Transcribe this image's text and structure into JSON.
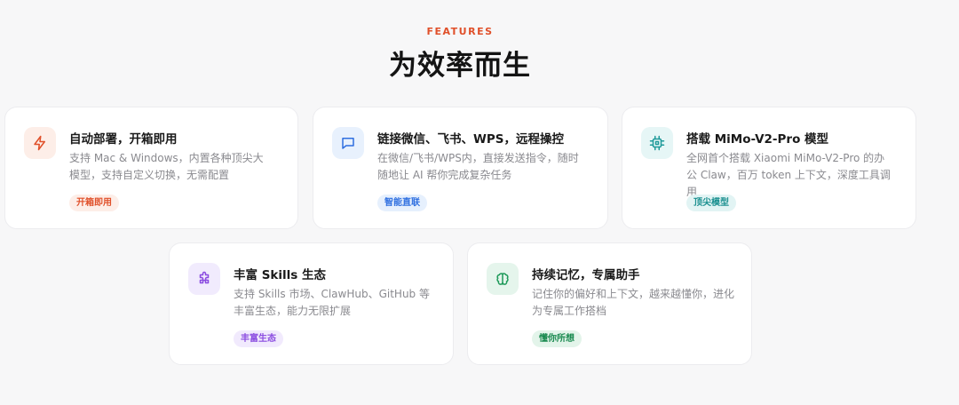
{
  "section": {
    "eyebrow": "FEATURES",
    "title": "为效率而生"
  },
  "features": [
    {
      "title": "自动部署，开箱即用",
      "description": "支持 Mac & Windows，内置各种顶尖大模型，支持自定义切换，无需配置",
      "tag": "开箱即用",
      "icon": "lightning-icon",
      "accent": "#e0502a"
    },
    {
      "title": "链接微信、飞书、WPS，远程操控",
      "description": "在微信/飞书/WPS内，直接发送指令，随时随地让 AI 帮你完成复杂任务",
      "tag": "智能直联",
      "icon": "message-icon",
      "accent": "#2f6fe0"
    },
    {
      "title": "搭载 MiMo-V2-Pro 模型",
      "description": "全网首个搭载 Xiaomi MiMo-V2-Pro 的办公 Claw，百万 token 上下文，深度工具调用",
      "tag": "顶尖模型",
      "icon": "chip-icon",
      "accent": "#1f9a9a"
    },
    {
      "title": "丰富 Skills 生态",
      "description": "支持 Skills 市场、ClawHub、GitHub 等丰富生态，能力无限扩展",
      "tag": "丰富生态",
      "icon": "puzzle-icon",
      "accent": "#8a4be0"
    },
    {
      "title": "持续记忆，专属助手",
      "description": "记住你的偏好和上下文，越来越懂你，进化为专属工作搭档",
      "tag": "懂你所想",
      "icon": "brain-icon",
      "accent": "#1f9a5a"
    }
  ]
}
